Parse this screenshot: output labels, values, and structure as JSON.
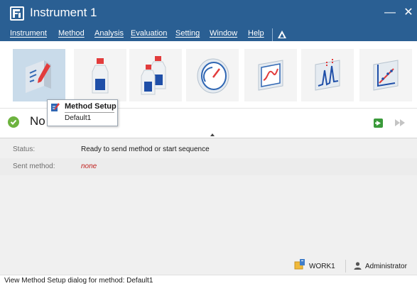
{
  "window": {
    "title": "Instrument 1",
    "minimize_glyph": "—",
    "close_glyph": "✕"
  },
  "menu": {
    "items": [
      "Instrument",
      "Method",
      "Analysis",
      "Evaluation",
      "Setting",
      "Window",
      "Help"
    ]
  },
  "toolbar": {
    "buttons": [
      {
        "name": "method-setup",
        "icon": "method-edit-icon",
        "active": true
      },
      {
        "name": "single-sample",
        "icon": "sample-bottle-icon"
      },
      {
        "name": "sample-sequence",
        "icon": "multi-bottle-icon"
      },
      {
        "name": "instrument-status",
        "icon": "gauge-icon"
      },
      {
        "name": "monitor",
        "icon": "signal-monitor-icon"
      },
      {
        "name": "data-analysis",
        "icon": "chromatogram-icon"
      },
      {
        "name": "reports",
        "icon": "calibration-plot-icon"
      }
    ]
  },
  "tooltip": {
    "title": "Method Setup",
    "subtitle": "Default1"
  },
  "status": {
    "big_text": "No"
  },
  "info": {
    "status_label": "Status:",
    "status_value": "Ready to send method or start sequence",
    "sent_label": "Sent method:",
    "sent_value": "none"
  },
  "footer": {
    "work_label": "WORK1",
    "user_label": "Administrator"
  },
  "statusbar": {
    "text": "View Method Setup dialog for method: Default1"
  },
  "colors": {
    "titlebar": "#2a5f93",
    "active_tool": "#c9dbea",
    "ok_green": "#6db33f",
    "error_red": "#c0201e"
  }
}
